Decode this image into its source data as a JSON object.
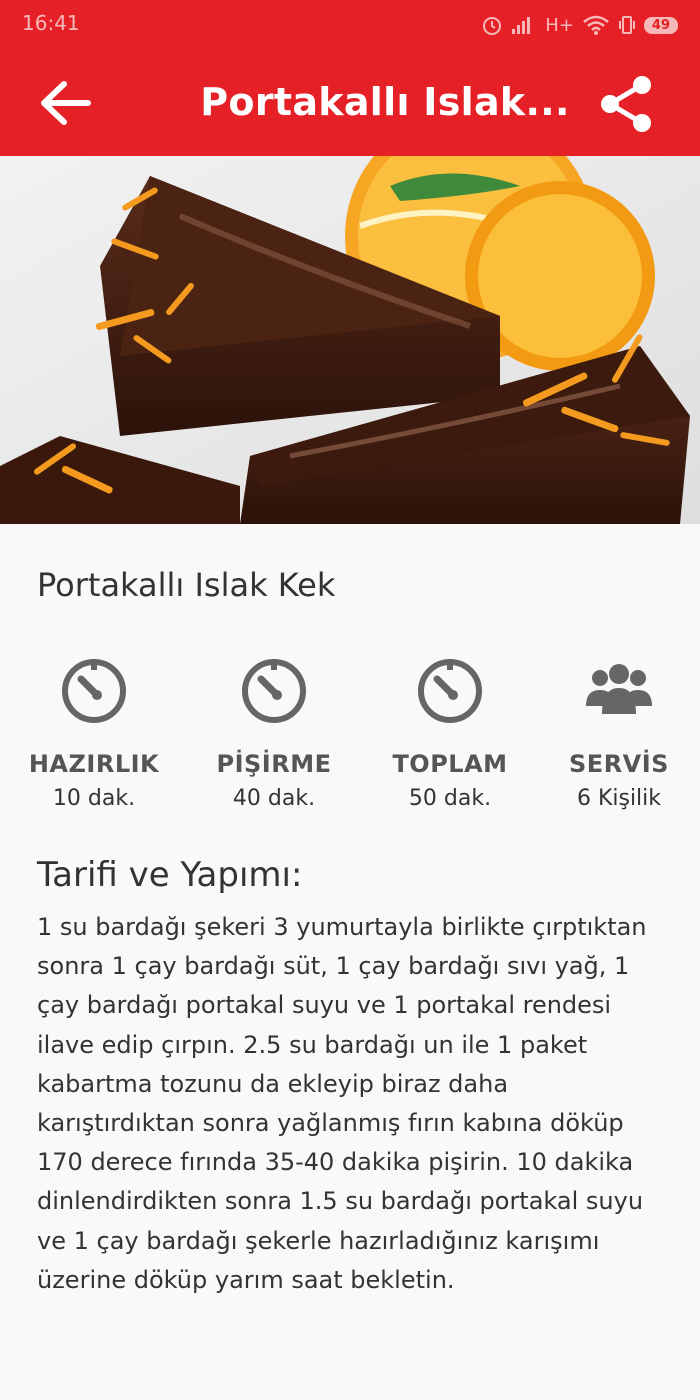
{
  "status_bar": {
    "time": "16:41",
    "network": "H+",
    "battery": "49"
  },
  "app_bar": {
    "title": "Portakallı Islak...",
    "back_icon": "arrow-left-icon",
    "share_icon": "share-icon",
    "color": "#e52127"
  },
  "hero_image": {
    "description_icon": "cake-photo"
  },
  "recipe": {
    "title": "Portakallı Islak Kek",
    "stats": [
      {
        "icon": "timer-icon",
        "label": "HAZIRLIK",
        "value": "10 dak."
      },
      {
        "icon": "timer-icon",
        "label": "PİŞİRME",
        "value": "40 dak."
      },
      {
        "icon": "timer-icon",
        "label": "TOPLAM",
        "value": "50 dak."
      },
      {
        "icon": "people-icon",
        "label": "SERVİS",
        "value": "6 Kişilik"
      }
    ],
    "section_title": "Tarifi ve Yapımı:",
    "instructions": "1 su bardağı şekeri 3 yumurtayla birlikte çırptıktan sonra 1 çay bardağı süt, 1 çay bardağı sıvı yağ, 1 çay bardağı portakal suyu ve 1 portakal rendesi ilave edip çırpın. 2.5 su bardağı un ile 1 paket kabartma tozunu da ekleyip biraz daha karıştırdıktan sonra yağlanmış fırın kabına döküp 170 derece fırında 35-40 dakika pişirin. 10 dakika dinlendirdikten sonra 1.5 su bardağı portakal suyu ve 1 çay bardağı şekerle hazırladığınız karışımı üzerine döküp yarım saat bekletin."
  }
}
